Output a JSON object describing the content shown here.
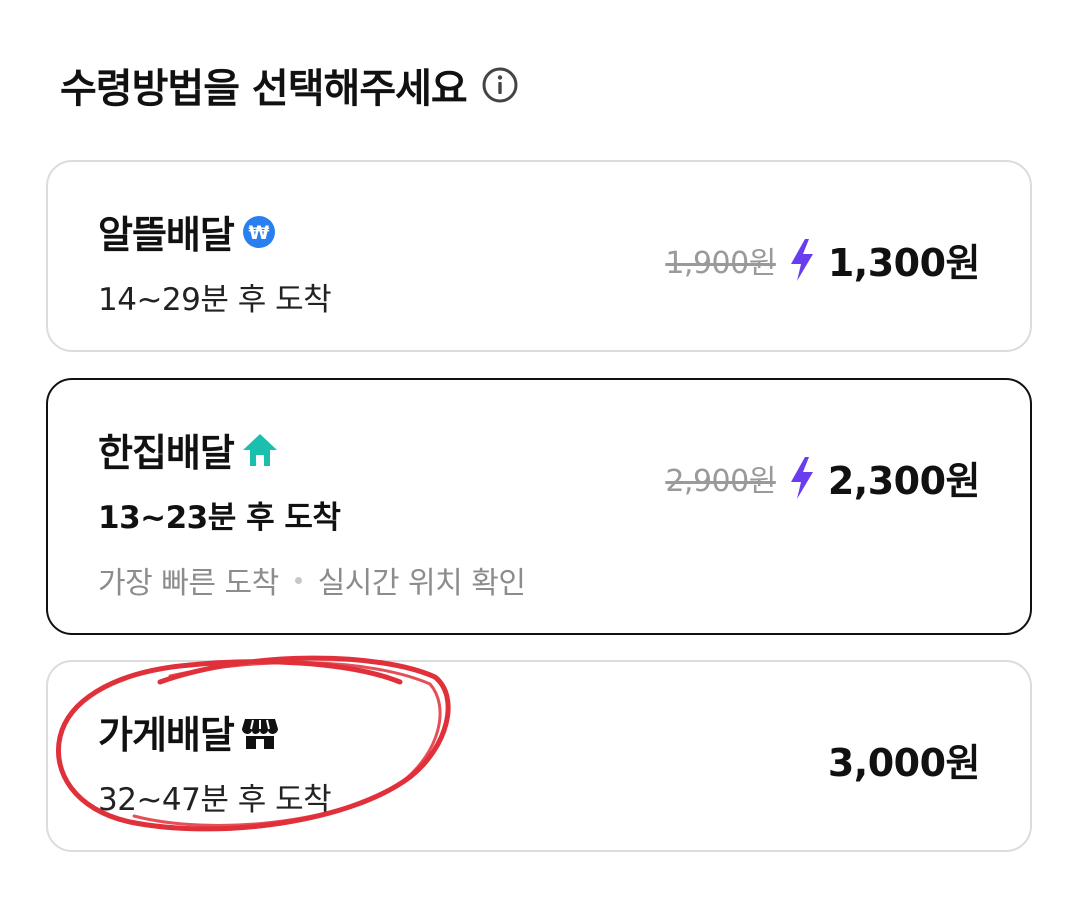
{
  "header": {
    "title": "수령방법을 선택해주세요"
  },
  "options": [
    {
      "name": "알뜰배달",
      "icon": "won-coin-icon",
      "time": "14~29분 후 도착",
      "original_price": "1,900원",
      "price": "1,300원"
    },
    {
      "name": "한집배달",
      "icon": "house-icon",
      "time": "13~23분 후 도착",
      "tags": [
        "가장 빠른 도착",
        "실시간 위치 확인"
      ],
      "original_price": "2,900원",
      "price": "2,300원",
      "selected": true
    },
    {
      "name": "가게배달",
      "icon": "store-icon",
      "time": "32~47분 후 도착",
      "price": "3,000원"
    }
  ],
  "colors": {
    "bolt": "#6a3cf0",
    "won_badge": "#2a7ff0",
    "house": "#1bbfae",
    "annotation": "#e0303a"
  }
}
